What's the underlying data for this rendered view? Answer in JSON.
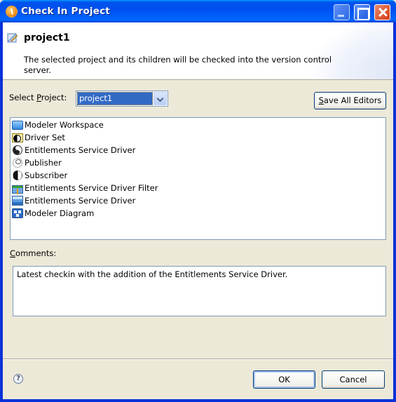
{
  "window": {
    "title": "Check In Project",
    "controls": {
      "minimize": "minimize",
      "maximize": "maximize",
      "close": "close"
    }
  },
  "header": {
    "title": "project1",
    "description": "The selected project and its children will be checked into the version control server."
  },
  "select_project": {
    "label_prefix": "Select ",
    "label_mnemonic": "P",
    "label_suffix": "roject:",
    "value": "project1"
  },
  "save_all_button": {
    "mnemonic": "S",
    "label_rest": "ave All Editors"
  },
  "tree": {
    "items": [
      {
        "label": "Modeler Workspace",
        "icon": "workspace-icon"
      },
      {
        "label": "Driver Set",
        "icon": "driver-set-icon"
      },
      {
        "label": "Entitlements Service Driver",
        "icon": "driver-yin-yang-icon"
      },
      {
        "label": "Publisher",
        "icon": "publisher-icon"
      },
      {
        "label": "Subscriber",
        "icon": "subscriber-icon"
      },
      {
        "label": "Entitlements Service Driver Filter",
        "icon": "filter-icon"
      },
      {
        "label": "Entitlements Service Driver",
        "icon": "driver-icon"
      },
      {
        "label": "Modeler Diagram",
        "icon": "diagram-icon"
      }
    ]
  },
  "comments": {
    "label_mnemonic": "C",
    "label_rest": "omments:",
    "value": "Latest checkin with the addition of the Entitlements Service Driver."
  },
  "footer": {
    "help_glyph": "?",
    "ok_label": "OK",
    "cancel_label": "Cancel"
  }
}
